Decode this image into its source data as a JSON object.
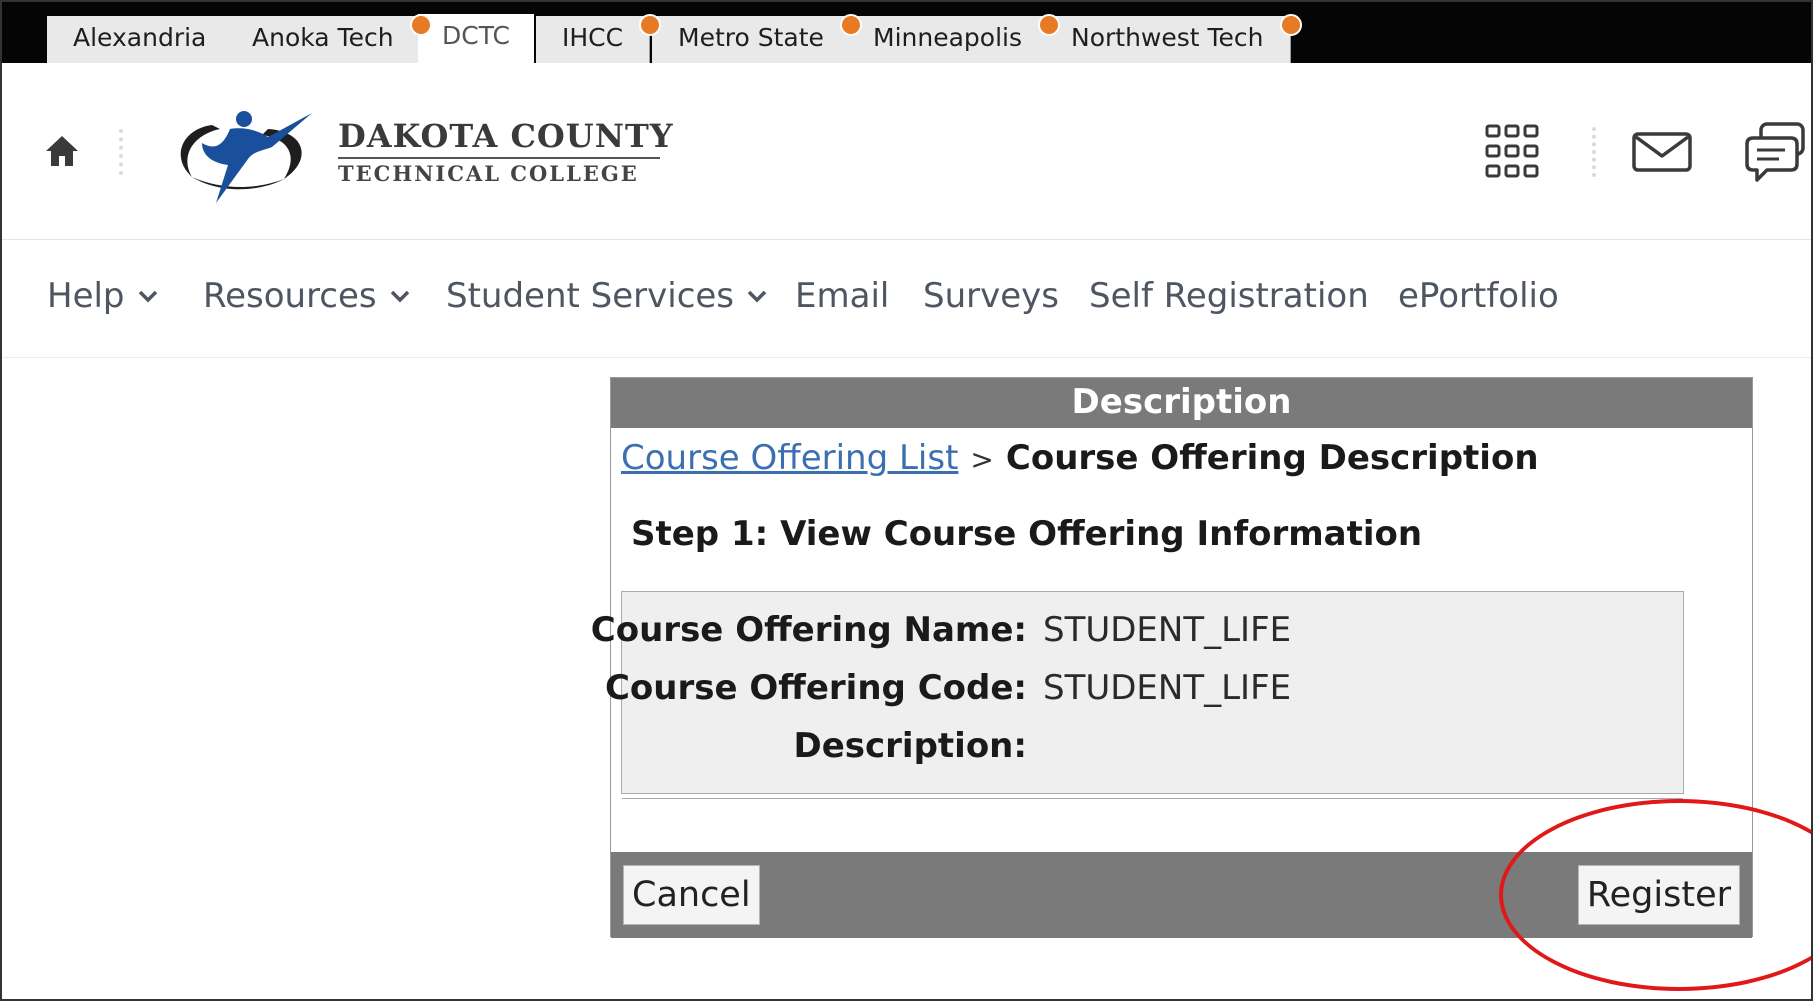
{
  "tabs": [
    {
      "label": "Alexandria",
      "active": false,
      "notification": false
    },
    {
      "label": "Anoka Tech",
      "active": false,
      "notification": true
    },
    {
      "label": "DCTC",
      "active": true,
      "notification": false
    },
    {
      "label": "IHCC",
      "active": false,
      "notification": true
    },
    {
      "label": "Metro State",
      "active": false,
      "notification": true
    },
    {
      "label": "Minneapolis",
      "active": false,
      "notification": true
    },
    {
      "label": "Northwest Tech",
      "active": false,
      "notification": true
    }
  ],
  "header": {
    "logo_title": "DAKOTA COUNTY",
    "logo_subtitle": "TECHNICAL COLLEGE",
    "icons": [
      "home-icon",
      "waffle-grid-icon",
      "mail-icon",
      "chat-icon"
    ]
  },
  "nav": {
    "items": [
      {
        "label": "Help",
        "dropdown": true
      },
      {
        "label": "Resources",
        "dropdown": true
      },
      {
        "label": "Student Services",
        "dropdown": true
      },
      {
        "label": "Email",
        "dropdown": false
      },
      {
        "label": "Surveys",
        "dropdown": false
      },
      {
        "label": "Self Registration",
        "dropdown": false
      },
      {
        "label": "ePortfolio",
        "dropdown": false
      }
    ]
  },
  "panel": {
    "header": "Description",
    "breadcrumb": {
      "link": "Course Offering List",
      "separator": ">",
      "current": "Course Offering Description"
    },
    "step": "Step 1: View Course Offering Information",
    "fields": [
      {
        "label": "Course Offering Name:",
        "value": "STUDENT_LIFE"
      },
      {
        "label": "Course Offering Code:",
        "value": "STUDENT_LIFE"
      },
      {
        "label": "Description:",
        "value": ""
      }
    ],
    "cancel_label": "Cancel",
    "register_label": "Register"
  },
  "colors": {
    "tab_bar": "#050505",
    "notification_dot": "#e97a24",
    "panel_header": "#7a7a7a",
    "link": "#3b6fb0",
    "annotation": "#e01818",
    "logo_blue": "#1a4f9c"
  }
}
